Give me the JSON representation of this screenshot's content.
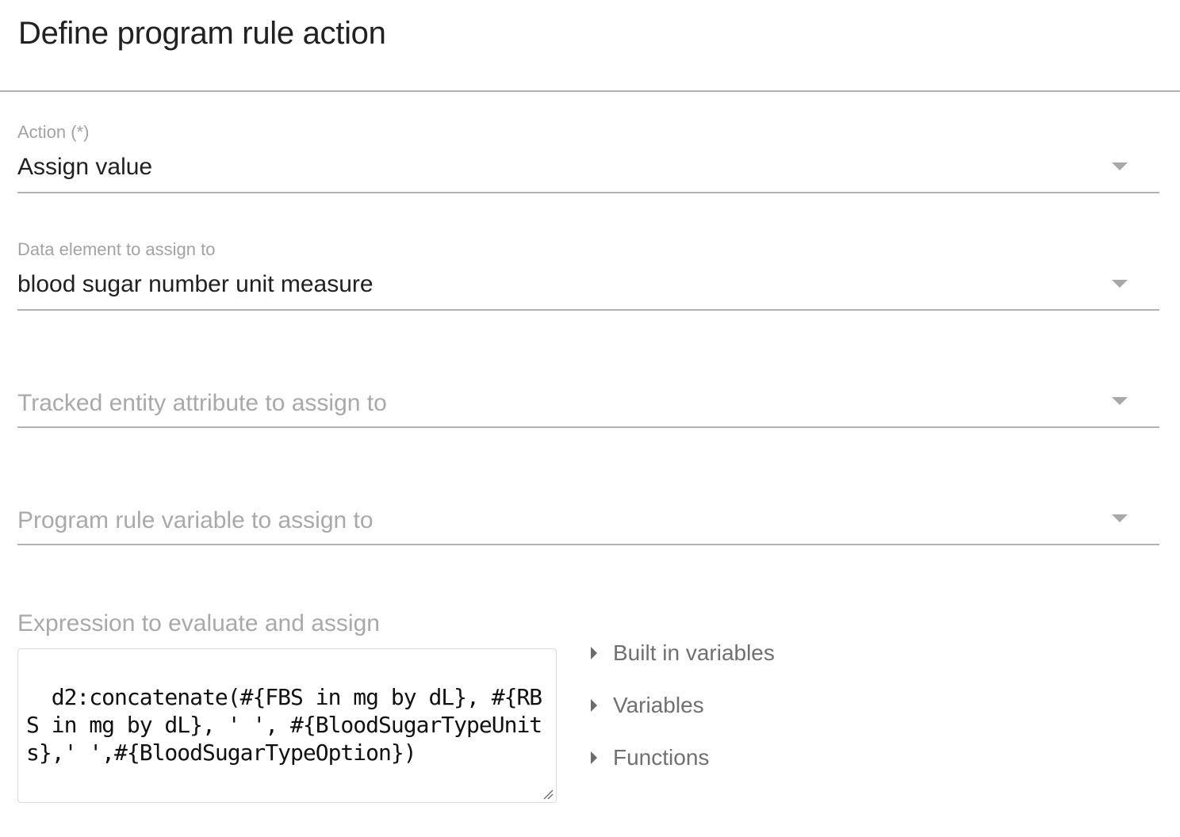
{
  "page": {
    "title": "Define program rule action"
  },
  "form": {
    "action": {
      "label": "Action (*)",
      "value": "Assign value"
    },
    "data_element": {
      "label": "Data element to assign to",
      "value": "blood sugar number unit measure"
    },
    "tracked_entity_attribute": {
      "placeholder": "Tracked entity attribute to assign to"
    },
    "program_rule_variable": {
      "placeholder": "Program rule variable to assign to"
    },
    "expression": {
      "label": "Expression to evaluate and assign",
      "value": "d2:concatenate(#{FBS in mg by dL}, #{RBS in mg by dL}, ' ', #{BloodSugarTypeUnits},' ',#{BloodSugarTypeOption})"
    }
  },
  "helpers": {
    "items": [
      {
        "label": "Built in variables",
        "icon": "caret-right-icon"
      },
      {
        "label": "Variables",
        "icon": "caret-right-icon"
      },
      {
        "label": "Functions",
        "icon": "caret-right-icon"
      }
    ]
  },
  "colors": {
    "text_primary": "#212121",
    "text_hint": "#a9a9a9",
    "divider": "#b3b3b3",
    "helper_text": "#707070"
  }
}
